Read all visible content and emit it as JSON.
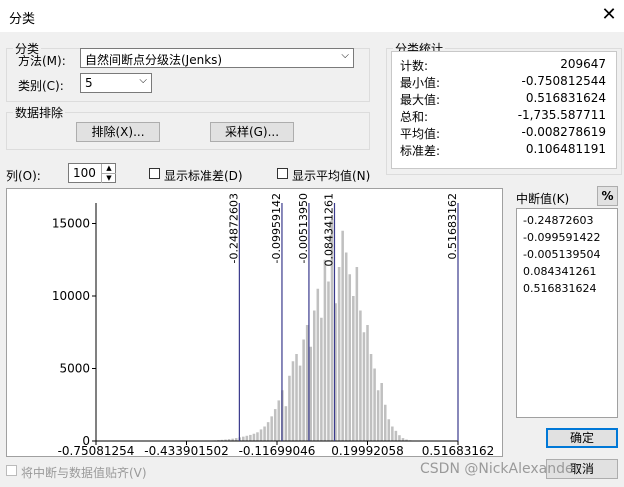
{
  "window": {
    "title": "分类",
    "close_symbol": "✕"
  },
  "classification": {
    "legend": "分类",
    "method_label": "方法(M):",
    "method_value": "自然间断点分级法(Jenks)",
    "classes_label": "类别(C):",
    "classes_value": "5"
  },
  "exclusion": {
    "legend": "数据排除",
    "exclude_button": "排除(X)...",
    "sample_button": "采样(G)..."
  },
  "stats": {
    "legend": "分类统计",
    "rows": [
      {
        "label": "计数:",
        "value": "209647"
      },
      {
        "label": "最小值:",
        "value": "-0.750812544"
      },
      {
        "label": "最大值:",
        "value": "0.516831624"
      },
      {
        "label": "总和:",
        "value": "-1,735.587711"
      },
      {
        "label": "平均值:",
        "value": "-0.008278619"
      },
      {
        "label": "标准差:",
        "value": "0.106481191"
      }
    ]
  },
  "columns": {
    "label": "列(O):",
    "value": "100",
    "show_std_label": "显示标准差(D)",
    "show_mean_label": "显示平均值(N)",
    "show_std_checked": false,
    "show_mean_checked": false
  },
  "breaks": {
    "label": "中断值(K)",
    "percent_button": "%",
    "values": [
      "-0.24872603",
      "-0.099591422",
      "-0.005139504",
      "0.084341261",
      "0.516831624"
    ]
  },
  "footer": {
    "snap_label": "将中断与数据值贴齐(V)",
    "ok_button": "确定",
    "cancel_button": "取消",
    "watermark": "CSDN @NickAlexander"
  },
  "chart_data": {
    "type": "bar",
    "title": "",
    "xlabel": "",
    "ylabel": "",
    "xlim": [
      -0.750812544,
      0.516831624
    ],
    "ylim": [
      0,
      16000
    ],
    "y_ticks": [
      0,
      5000,
      10000,
      15000
    ],
    "y_tick_labels": [
      "0",
      "5000",
      "10000",
      "15000"
    ],
    "x_ticks": [
      -0.750812544,
      -0.433901502,
      -0.11699046,
      0.1999205821,
      0.516831624
    ],
    "x_tick_labels": [
      "-0.75081254",
      "-0.433901502",
      "-0.11699046",
      "0.19992058",
      "0.51683162"
    ],
    "bar_color": "#c0c0c0",
    "break_line_color": "#3a3a8c",
    "break_values": [
      -0.24872603,
      -0.099591422,
      -0.005139504,
      0.084341261,
      0.516831624
    ],
    "break_labels": [
      "-0.24872603",
      "-0.09959142",
      "-0.00513950",
      "0.084341261",
      "0.51683162"
    ],
    "bin_count": 100,
    "bin_values": [
      0,
      0,
      0,
      0,
      0,
      0,
      0,
      0,
      0,
      0,
      0,
      0,
      0,
      0,
      0,
      0,
      0,
      0,
      0,
      0,
      0,
      0,
      0,
      0,
      0,
      0,
      0,
      0,
      0,
      0,
      0,
      0,
      20,
      40,
      60,
      80,
      100,
      130,
      160,
      200,
      250,
      300,
      360,
      420,
      500,
      600,
      800,
      1000,
      1300,
      1700,
      2200,
      2800,
      3500,
      2400,
      4500,
      5500,
      6000,
      5200,
      7000,
      8000,
      6500,
      9000,
      10500,
      8500,
      12500,
      11000,
      15300,
      9500,
      12000,
      14500,
      13000,
      11500,
      10000,
      12000,
      9000,
      7500,
      8000,
      6000,
      5000,
      3500,
      4000,
      2500,
      1500,
      1000,
      700,
      400,
      200,
      100,
      50,
      20,
      10,
      0,
      0,
      0,
      0,
      0,
      0,
      0,
      0,
      0,
      0,
      0
    ]
  }
}
